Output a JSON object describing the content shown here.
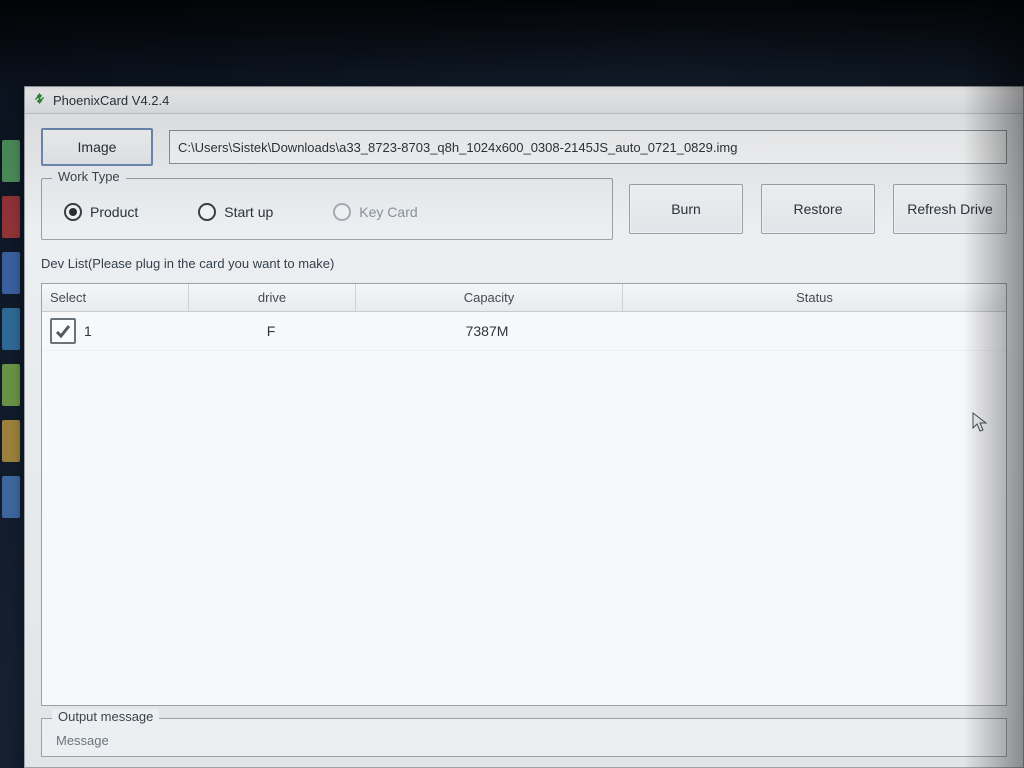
{
  "window": {
    "title": "PhoenixCard V4.2.4"
  },
  "image_row": {
    "button_label": "Image",
    "path": "C:\\Users\\Sistek\\Downloads\\a33_8723-8703_q8h_1024x600_0308-2145JS_auto_0721_0829.img"
  },
  "worktype": {
    "legend": "Work Type",
    "options": {
      "product": "Product",
      "startup": "Start up",
      "keycard": "Key Card"
    },
    "selected": "product",
    "keycard_disabled": true
  },
  "actions": {
    "burn": "Burn",
    "restore": "Restore",
    "refresh": "Refresh Drive"
  },
  "devlist": {
    "label": "Dev List(Please plug in the card you want to make)",
    "columns": {
      "select": "Select",
      "drive": "drive",
      "capacity": "Capacity",
      "status": "Status"
    },
    "rows": [
      {
        "checked": true,
        "index": "1",
        "drive": "F",
        "capacity": "7387M",
        "status": ""
      }
    ]
  },
  "output": {
    "legend": "Output message",
    "message_header": "Message"
  }
}
